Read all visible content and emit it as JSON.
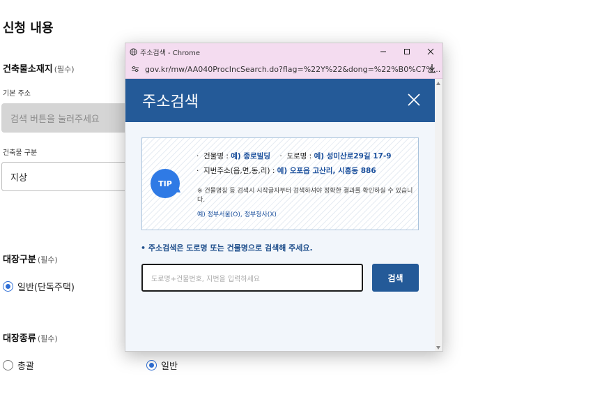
{
  "page": {
    "title": "신청 내용",
    "building_location": {
      "label": "건축물소재지",
      "required": "(필수)"
    },
    "base_address": {
      "label": "기본 주소",
      "placeholder": "검색 버튼을 눌러주세요"
    },
    "building_type": {
      "label": "건축물 구분",
      "value": "지상"
    },
    "ledger_type": {
      "label": "대장구분",
      "required": "(필수)",
      "option": "일반(단독주택)"
    },
    "ledger_kind": {
      "label": "대장종류",
      "required": "(필수)",
      "options": [
        "총괄",
        "일반"
      ],
      "selected": "일반"
    }
  },
  "popup": {
    "window_title": "주소검색 - Chrome",
    "url": "gov.kr/mw/AA040ProcIncSearch.do?flag=%22Y%22&dong=%22%B0%C7%...",
    "header_title": "주소검색",
    "tip": {
      "badge": "TIP",
      "line1_label1": "건물명 : ",
      "line1_ex1": "예) 종로빌딩",
      "line1_label2": "도로명 : ",
      "line1_ex2": "예) 성미산로29길 17-9",
      "line2_label": "지번주소(읍,면,동,리) : ",
      "line2_ex": "예) 오포읍 고산리, 시흥동 886",
      "note": "※ 건물명칭 등 검색시 시작글자부터 검색하셔야 정확한 결과를 확인하실 수 있습니다.",
      "example": "예) 정부서울(O), 정부청사(X)"
    },
    "guide": "주소검색은 도로명 또는 건물명으로 검색해 주세요.",
    "search_placeholder": "도로명+건물번호, 지번을 입력하세요",
    "search_button": "검색"
  }
}
